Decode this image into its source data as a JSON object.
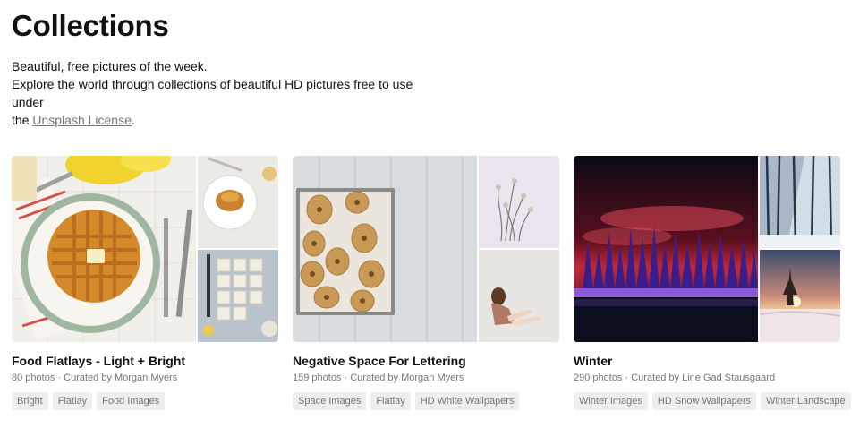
{
  "page": {
    "title": "Collections",
    "intro_line1": "Beautiful, free pictures of the week.",
    "intro_line2": "Explore the world through collections of beautiful HD pictures free to use under",
    "intro_line3_prefix": "the",
    "license_link": "Unsplash License",
    "intro_line3_suffix": "."
  },
  "collections": [
    {
      "title": "Food Flatlays - Light + Bright",
      "photo_count": "80 photos",
      "separator": "·",
      "curator": "Curated by Morgan Myers",
      "tags": [
        "Bright",
        "Flatlay",
        "Food Images"
      ]
    },
    {
      "title": "Negative Space For Lettering",
      "photo_count": "159 photos",
      "separator": "·",
      "curator": "Curated by Morgan Myers",
      "tags": [
        "Space Images",
        "Flatlay",
        "HD White Wallpapers"
      ]
    },
    {
      "title": "Winter",
      "photo_count": "290 photos",
      "separator": "·",
      "curator": "Curated by Line Gad Stausgaard",
      "tags": [
        "Winter Images",
        "HD Snow Wallpapers",
        "Winter Landscape"
      ]
    }
  ],
  "colors": {
    "text": "#111111",
    "muted": "#767676",
    "tag_background": "#eeeeee"
  }
}
